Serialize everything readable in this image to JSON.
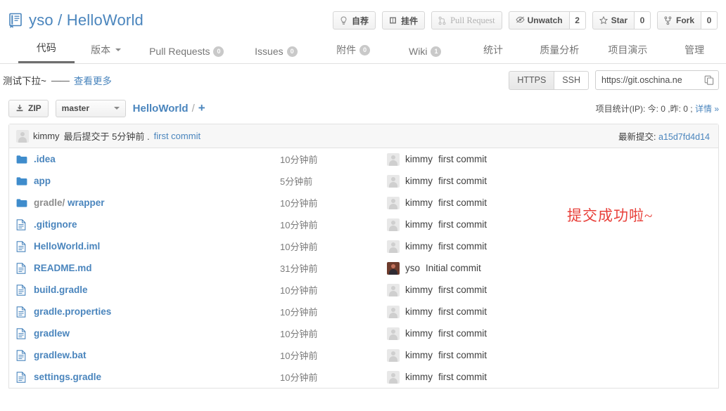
{
  "header": {
    "owner": "yso",
    "separator": " / ",
    "repo": "HelloWorld",
    "book_icon": "book-icon",
    "actions": [
      {
        "label": "自荐",
        "icon": "lightbulb-icon",
        "count": null,
        "muted": false
      },
      {
        "label": "挂件",
        "icon": "widget-icon",
        "count": null,
        "muted": false
      },
      {
        "label": "Pull Request",
        "icon": "pull-request-icon",
        "count": null,
        "muted": true
      },
      {
        "label": "Unwatch",
        "icon": "eye-icon",
        "count": "2",
        "muted": false
      },
      {
        "label": "Star",
        "icon": "star-icon",
        "count": "0",
        "muted": false
      },
      {
        "label": "Fork",
        "icon": "fork-icon",
        "count": "0",
        "muted": false
      }
    ]
  },
  "nav": {
    "tabs": [
      {
        "label": "代码",
        "badge": null,
        "active": true,
        "caret": false
      },
      {
        "label": "版本",
        "badge": null,
        "active": false,
        "caret": true
      },
      {
        "label": "Pull Requests",
        "badge": "0",
        "active": false,
        "caret": false
      },
      {
        "label": "Issues",
        "badge": "0",
        "active": false,
        "caret": false
      },
      {
        "label": "附件",
        "badge": "0",
        "active": false,
        "caret": false
      },
      {
        "label": "Wiki",
        "badge": "1",
        "active": false,
        "caret": false
      },
      {
        "label": "统计",
        "badge": null,
        "active": false,
        "caret": false
      },
      {
        "label": "质量分析",
        "badge": null,
        "active": false,
        "caret": false
      },
      {
        "label": "项目演示",
        "badge": null,
        "active": false,
        "caret": false
      },
      {
        "label": "管理",
        "badge": null,
        "active": false,
        "caret": false
      }
    ]
  },
  "description": {
    "text": "测试下拉~",
    "dash": "——",
    "more_link": "查看更多"
  },
  "clone": {
    "https_label": "HTTPS",
    "ssh_label": "SSH",
    "url_value": "https://git.oschina.ne",
    "url_placeholder": "https://git.oschina.net/",
    "copy_icon": "copy-icon"
  },
  "toolbar": {
    "zip_label": "ZIP",
    "zip_icon": "download-icon",
    "branch_label": "master",
    "breadcrumb_repo": "HelloWorld",
    "breadcrumb_sep": "/",
    "breadcrumb_plus": "+",
    "stats_text": "项目统计(IP): 今: 0 ,昨: 0 ;",
    "stats_link": "详情 »"
  },
  "commit_bar": {
    "author": "kimmy",
    "text": "最后提交于 5分钟前 .",
    "message": "first commit",
    "latest_label": "最新提交:",
    "latest_sha": "a15d7fd4d14"
  },
  "files": [
    {
      "name": ".idea",
      "dim_prefix": "",
      "type": "folder",
      "time": "10分钟前",
      "author": "kimmy",
      "message": "first commit",
      "avatar": "gray"
    },
    {
      "name": "app",
      "dim_prefix": "",
      "type": "folder",
      "time": "5分钟前",
      "author": "kimmy",
      "message": "first commit",
      "avatar": "gray"
    },
    {
      "name": "wrapper",
      "dim_prefix": "gradle/",
      "type": "folder",
      "time": "10分钟前",
      "author": "kimmy",
      "message": "first commit",
      "avatar": "gray"
    },
    {
      "name": ".gitignore",
      "dim_prefix": "",
      "type": "file",
      "time": "10分钟前",
      "author": "kimmy",
      "message": "first commit",
      "avatar": "gray"
    },
    {
      "name": "HelloWorld.iml",
      "dim_prefix": "",
      "type": "file",
      "time": "10分钟前",
      "author": "kimmy",
      "message": "first commit",
      "avatar": "gray"
    },
    {
      "name": "README.md",
      "dim_prefix": "",
      "type": "file",
      "time": "31分钟前",
      "author": "yso",
      "message": "Initial commit",
      "avatar": "color"
    },
    {
      "name": "build.gradle",
      "dim_prefix": "",
      "type": "file",
      "time": "10分钟前",
      "author": "kimmy",
      "message": "first commit",
      "avatar": "gray"
    },
    {
      "name": "gradle.properties",
      "dim_prefix": "",
      "type": "file",
      "time": "10分钟前",
      "author": "kimmy",
      "message": "first commit",
      "avatar": "gray"
    },
    {
      "name": "gradlew",
      "dim_prefix": "",
      "type": "file",
      "time": "10分钟前",
      "author": "kimmy",
      "message": "first commit",
      "avatar": "gray"
    },
    {
      "name": "gradlew.bat",
      "dim_prefix": "",
      "type": "file",
      "time": "10分钟前",
      "author": "kimmy",
      "message": "first commit",
      "avatar": "gray"
    },
    {
      "name": "settings.gradle",
      "dim_prefix": "",
      "type": "file",
      "time": "10分钟前",
      "author": "kimmy",
      "message": "first commit",
      "avatar": "gray"
    }
  ],
  "annotation": {
    "text": "提交成功啦~",
    "color": "#e8403a"
  },
  "colors": {
    "link": "#4a85bd",
    "accent_red": "#e8403a",
    "text": "#3f3f3f",
    "muted": "#7b7b7b",
    "border": "#e2e2e2"
  }
}
